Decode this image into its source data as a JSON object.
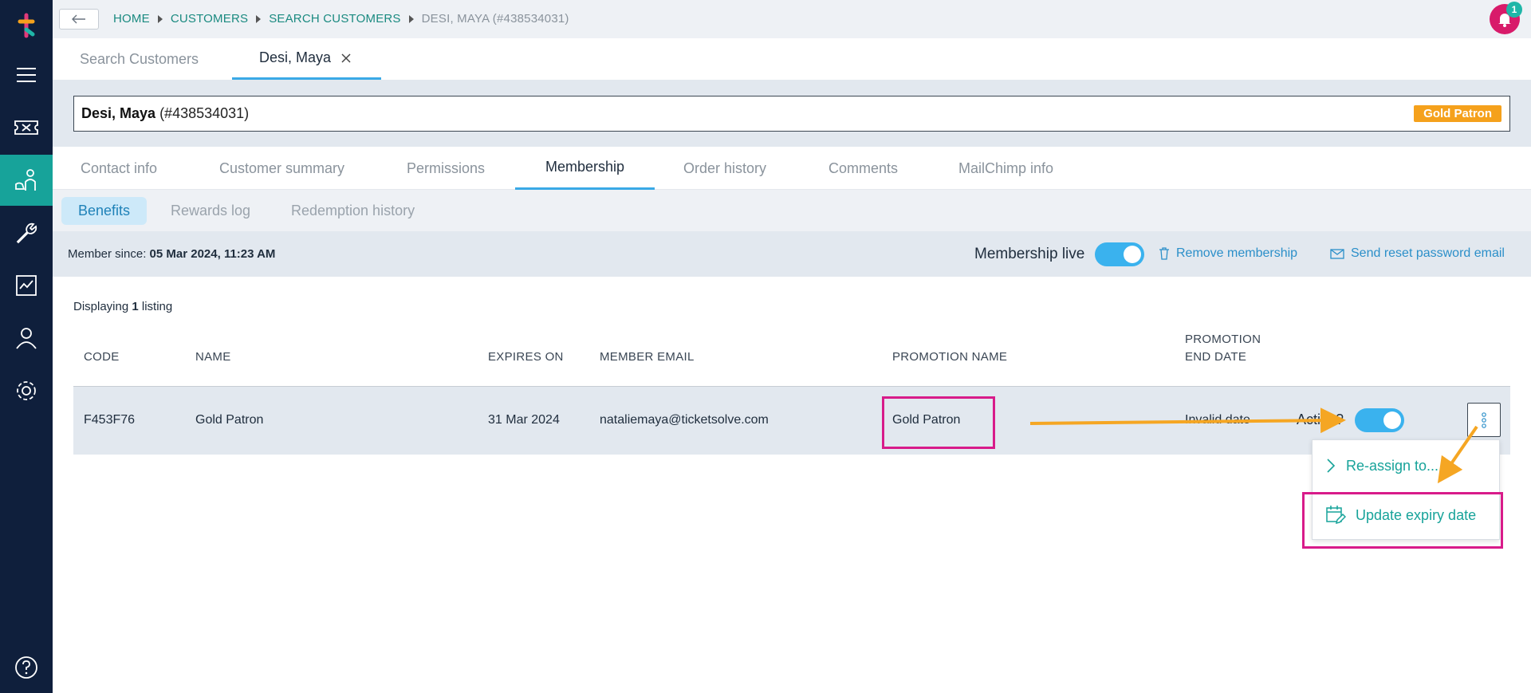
{
  "breadcrumb": [
    "HOME",
    "CUSTOMERS",
    "SEARCH CUSTOMERS",
    "DESI, MAYA (#438534031)"
  ],
  "notifications": {
    "count": "1"
  },
  "page_tabs": [
    {
      "label": "Search Customers"
    },
    {
      "label": "Desi, Maya"
    }
  ],
  "customer": {
    "name": "Desi, Maya",
    "id": "(#438534031)",
    "tier_badge": "Gold Patron"
  },
  "section_tabs": [
    "Contact info",
    "Customer summary",
    "Permissions",
    "Membership",
    "Order history",
    "Comments",
    "MailChimp info"
  ],
  "sub_tabs": [
    "Benefits",
    "Rewards log",
    "Redemption history"
  ],
  "membership": {
    "since_label": "Member since:",
    "since_value": "05 Mar 2024, 11:23 AM",
    "live_label": "Membership live",
    "live": true,
    "remove_label": "Remove membership",
    "reset_label": "Send reset password email"
  },
  "listing": {
    "prefix": "Displaying",
    "count": "1",
    "suffix": "listing"
  },
  "table": {
    "headers": {
      "code": "CODE",
      "name": "NAME",
      "expires": "EXPIRES ON",
      "email": "MEMBER EMAIL",
      "promo": "PROMOTION NAME",
      "promo_end_1": "PROMOTION",
      "promo_end_2": "END DATE"
    },
    "rows": [
      {
        "code": "F453F76",
        "name": "Gold Patron",
        "expires": "31 Mar 2024",
        "email": "nataliemaya@ticketsolve.com",
        "promo": "Gold Patron",
        "promo_end": "Invalid date",
        "active_label": "Active?",
        "active": true
      }
    ]
  },
  "row_menu": {
    "items": [
      "Re-assign to...",
      "Update expiry date"
    ]
  },
  "colors": {
    "sidebar": "#0f1f3c",
    "accent": "#17a39a",
    "link": "#2b8fc9",
    "badge": "#f5a11c",
    "highlight": "#d81b8a",
    "arrow": "#f5a623"
  }
}
